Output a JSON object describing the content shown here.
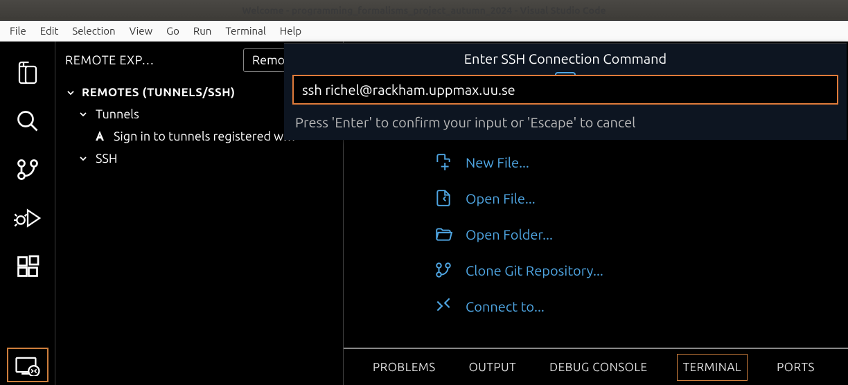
{
  "titlebar": "Welcome - programming_formalisms_project_autumn_2024 - Visual Studio Code",
  "menubar": [
    "File",
    "Edit",
    "Selection",
    "View",
    "Go",
    "Run",
    "Terminal",
    "Help"
  ],
  "sidebar": {
    "title": "REMOTE EXP…",
    "dropdown": "Remotes (T",
    "section": "REMOTES (TUNNELS/SSH)",
    "item_tunnels": "Tunnels",
    "item_signin": "Sign in to tunnels registered w…",
    "item_ssh": "SSH"
  },
  "welcome": {
    "new_file": "New File...",
    "open_file": "Open File...",
    "open_folder": "Open Folder...",
    "clone_repo": "Clone Git Repository...",
    "connect_to": "Connect to..."
  },
  "panels": {
    "problems": "PROBLEMS",
    "output": "OUTPUT",
    "debug_console": "DEBUG CONSOLE",
    "terminal": "TERMINAL",
    "ports": "PORTS"
  },
  "quickinput": {
    "title": "Enter SSH Connection Command",
    "value": "ssh richel@rackham.uppmax.uu.se",
    "hint": "Press 'Enter' to confirm your input or 'Escape' to cancel"
  }
}
